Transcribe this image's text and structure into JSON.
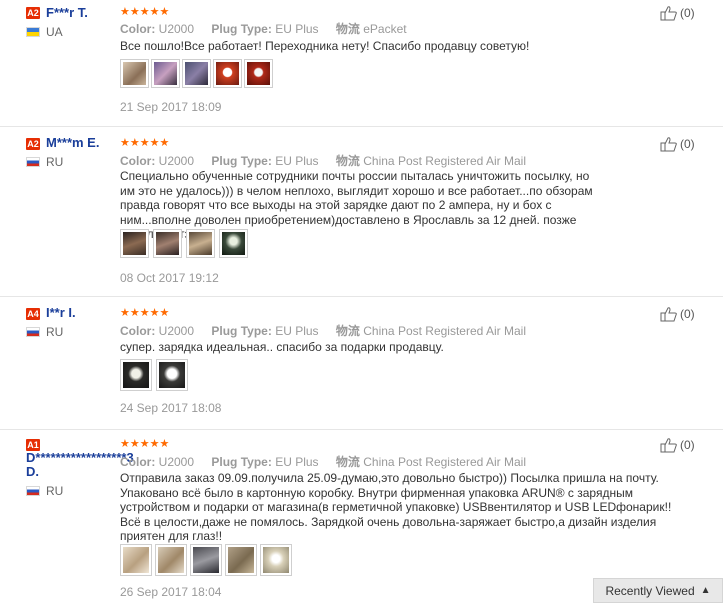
{
  "reviews": [
    {
      "level": "A2",
      "user": "F***r T.",
      "country": "UA",
      "color_label": "Color:",
      "color_value": "U2000",
      "plug_label": "Plug Type:",
      "plug_value": "EU Plus",
      "logistics_label": "物流",
      "logistics_value": "ePacket",
      "text": "Все пошло!Все работает! Переходника нету! Спасибо продавцу советую!",
      "date": "21 Sep 2017 18:09",
      "helpful": "(0)",
      "rating": 5
    },
    {
      "level": "A2",
      "user": "M***m E.",
      "country": "RU",
      "color_label": "Color:",
      "color_value": "U2000",
      "plug_label": "Plug Type:",
      "plug_value": "EU Plus",
      "logistics_label": "物流",
      "logistics_value": "China Post Registered Air Mail",
      "text": "Специально обученные сотрудники почты россии пыталась уничтожить посылку, но им это не удалось))) в челом неплохо, выглядит хорошо и все работает...по обзорам правда говорят что все выходы на этой зарядке дают по 2 ампера, ну и бох с ним...вполне доволен приобретением)доставлено в Ярославль за 12 дней. позже дополню отзыв)",
      "date": "08 Oct 2017 19:12",
      "helpful": "(0)",
      "rating": 5
    },
    {
      "level": "A4",
      "user": "I**r I.",
      "country": "RU",
      "color_label": "Color:",
      "color_value": "U2000",
      "plug_label": "Plug Type:",
      "plug_value": "EU Plus",
      "logistics_label": "物流",
      "logistics_value": "China Post Registered Air Mail",
      "text": "супер. зарядка идеальная.. спасибо за подарки продавцу.",
      "date": "24 Sep 2017 18:08",
      "helpful": "(0)",
      "rating": 5
    },
    {
      "level": "A1",
      "user": "D******************3 D.",
      "country": "RU",
      "color_label": "Color:",
      "color_value": "U2000",
      "plug_label": "Plug Type:",
      "plug_value": "EU Plus",
      "logistics_label": "物流",
      "logistics_value": "China Post Registered Air Mail",
      "text": "Отправила заказ 09.09.получила 25.09-думаю,это довольно быстро)) Посылка пришла на почту. Упаковано всё было в картонную коробку. Внутри фирменная упаковка ARUN® с зарядным устройством и подарки от магазина(в герметичной упаковке) USBвентилятор и USB LEDфонарик!!Всё в целости,даже не помялось. Зарядкой очень довольна-заряжает быстро,а дизайн изделия приятен для глаз!!",
      "date": "26 Sep 2017 18:04",
      "helpful": "(0)",
      "rating": 5
    }
  ],
  "footer": {
    "recently_viewed": "Recently Viewed"
  },
  "colors": {
    "stars": "#ff6a00",
    "badge": "#e62e04",
    "username": "#1a3e9a"
  }
}
